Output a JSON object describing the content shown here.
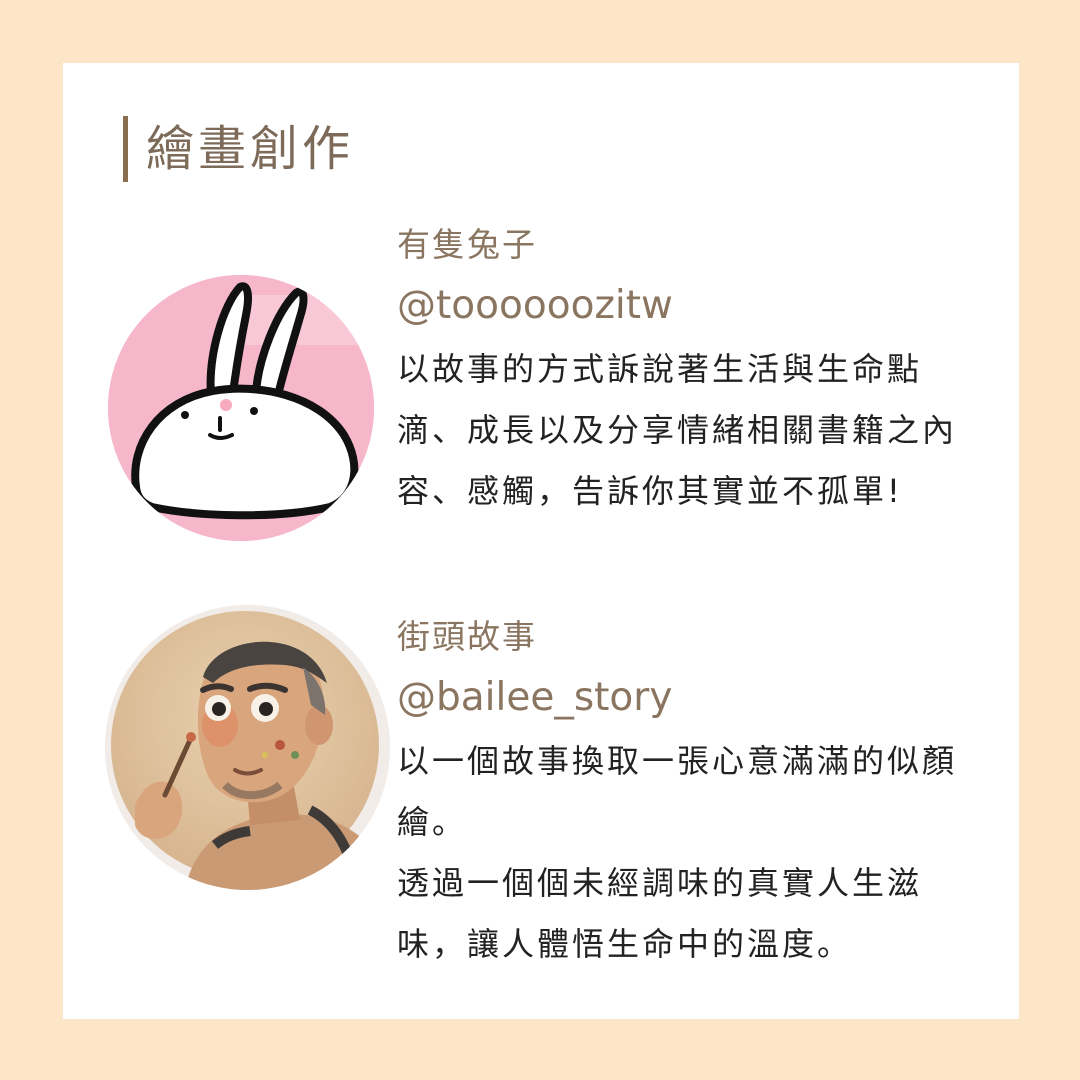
{
  "title": "繪畫創作",
  "profiles": [
    {
      "name": "有隻兔子",
      "handle": "@toooooozitw",
      "description": [
        "以故事的方式訴說著生活與生命點滴、成長以及分享情緒相關書籍之內容、感觸，告訴你其實並不孤單!"
      ],
      "avatar_icon": "bunny-avatar"
    },
    {
      "name": "街頭故事",
      "handle": "@bailee_story",
      "description": [
        "以一個故事換取一張心意滿滿的似顏繪。",
        "透過一個個未經調味的真實人生滋味，讓人體悟生命中的溫度。"
      ],
      "avatar_icon": "painter-portrait-avatar"
    }
  ],
  "colors": {
    "background": "#fde6c8",
    "card": "#ffffff",
    "accent": "#8a7560",
    "text": "#222222",
    "bunny_bg": "#f7b7cb"
  }
}
